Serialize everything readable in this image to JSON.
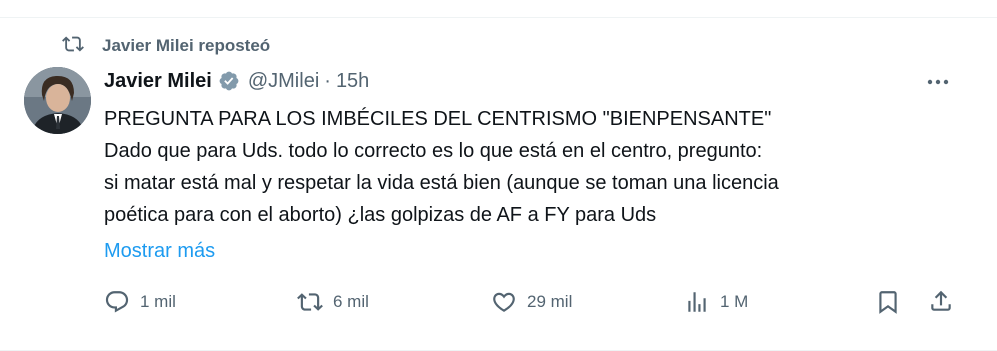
{
  "repost": {
    "label": "Javier Milei reposteó"
  },
  "author": {
    "name": "Javier Milei",
    "handle": "@JMilei",
    "separator": "·",
    "time": "15h"
  },
  "tweet": {
    "lines": [
      "PREGUNTA PARA LOS IMBÉCILES DEL CENTRISMO \"BIENPENSANTE\"",
      "Dado que para Uds. todo lo correcto es lo que está en el centro, pregunto:",
      "si matar está mal y respetar la vida está bien (aunque se toman una licencia",
      "poética para con el aborto) ¿las golpizas de AF a FY para Uds"
    ],
    "show_more": "Mostrar más"
  },
  "actions": {
    "replies": "1 mil",
    "reposts": "6 mil",
    "likes": "29 mil",
    "views": "1 M"
  },
  "icons": [
    "repost-icon",
    "verified-badge-icon",
    "more-icon",
    "reply-icon",
    "retweet-icon",
    "like-icon",
    "views-icon",
    "bookmark-icon",
    "share-icon"
  ],
  "colors": {
    "accent": "#1d9bf0",
    "muted": "#536471",
    "text": "#0f1419"
  }
}
